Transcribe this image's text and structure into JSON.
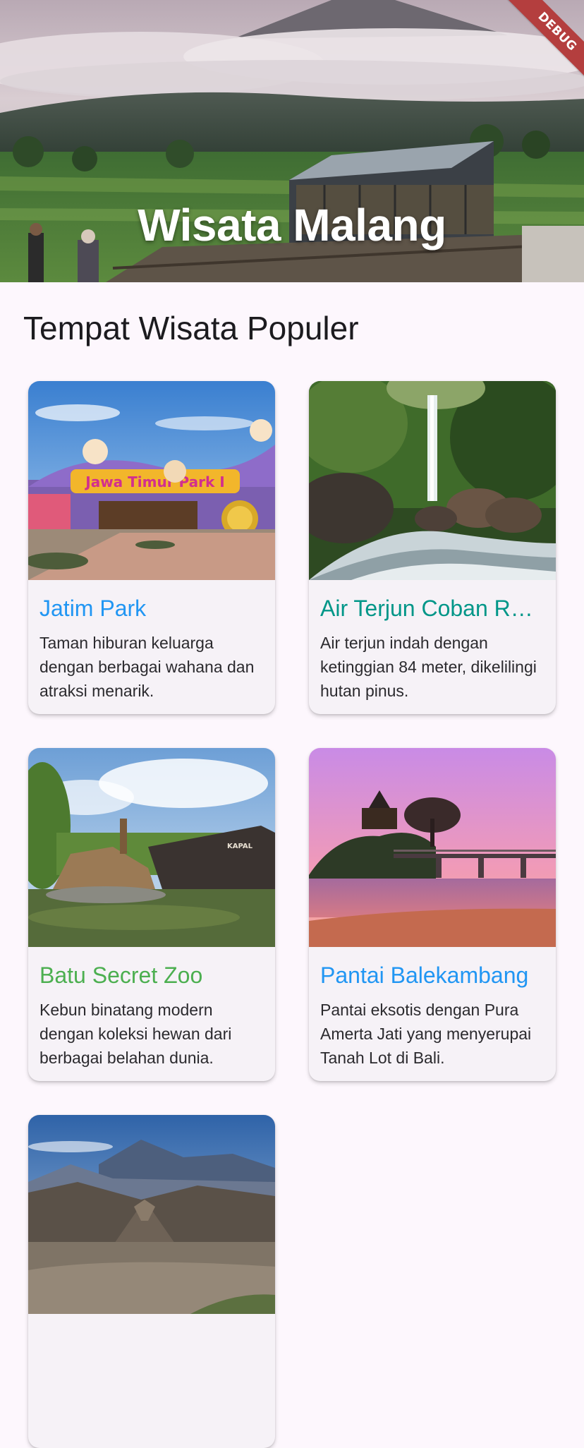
{
  "app": {
    "title": "Wisata Malang",
    "debug_label": "DEBUG"
  },
  "section": {
    "title": "Tempat Wisata Populer"
  },
  "places": [
    {
      "name": "Jatim Park",
      "description": "Taman hiburan keluarga dengan berbagai wahana dan atraksi menarik.",
      "title_color": "#2196f3",
      "image": "theme-park-photo"
    },
    {
      "name": "Air Terjun Coban Rondo",
      "description": "Air terjun indah dengan ketinggian 84 meter, dikelilingi hutan pinus.",
      "title_color": "#009688",
      "image": "waterfall-photo"
    },
    {
      "name": "Batu Secret Zoo",
      "description": "Kebun binatang modern dengan koleksi hewan dari berbagai belahan dunia.",
      "title_color": "#4caf50",
      "image": "zoo-photo"
    },
    {
      "name": "Pantai Balekambang",
      "description": "Pantai eksotis dengan Pura Amerta Jati yang menyerupai Tanah Lot di Bali.",
      "title_color": "#2196f3",
      "image": "beach-sunset-photo"
    },
    {
      "name": "",
      "description": "",
      "title_color": "#2196f3",
      "image": "mountain-bromo-photo"
    }
  ]
}
